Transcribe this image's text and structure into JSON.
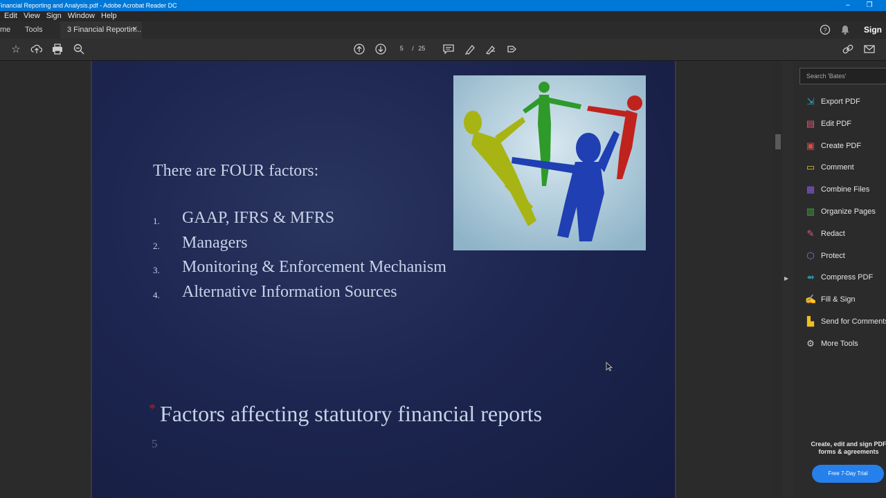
{
  "window": {
    "title": "Financial Reporting and Analysis.pdf - Adobe Acrobat Reader DC"
  },
  "menu": [
    "Edit",
    "View",
    "Sign",
    "Window",
    "Help"
  ],
  "tabs": {
    "home": "me",
    "tools": "Tools",
    "document": "3 Financial Reportin...",
    "sign_in": "Sign I"
  },
  "toolbar": {
    "current_page": "5",
    "page_separator": "/",
    "total_pages": "25"
  },
  "slide": {
    "heading": "There are FOUR factors:",
    "items": [
      {
        "num": "1.",
        "text": "GAAP, IFRS & MFRS"
      },
      {
        "num": "2.",
        "text": "Managers"
      },
      {
        "num": "3.",
        "text": "Monitoring & Enforcement Mechanism"
      },
      {
        "num": "4.",
        "text": "Alternative Information Sources"
      }
    ],
    "title_marker": "*",
    "title": "Factors affecting statutory financial reports",
    "page_number": "5"
  },
  "right_panel": {
    "search_placeholder": "Search 'Bates'",
    "tools": [
      {
        "label": "Export PDF",
        "icon": "export-pdf-icon",
        "color": "#2ab0c8"
      },
      {
        "label": "Edit PDF",
        "icon": "edit-pdf-icon",
        "color": "#e0587a"
      },
      {
        "label": "Create PDF",
        "icon": "create-pdf-icon",
        "color": "#e04848"
      },
      {
        "label": "Comment",
        "icon": "comment-icon",
        "color": "#f0c020"
      },
      {
        "label": "Combine Files",
        "icon": "combine-files-icon",
        "color": "#8a5ae0"
      },
      {
        "label": "Organize Pages",
        "icon": "organize-pages-icon",
        "color": "#40b040"
      },
      {
        "label": "Redact",
        "icon": "redact-icon",
        "color": "#e0587a"
      },
      {
        "label": "Protect",
        "icon": "protect-icon",
        "color": "#8a70e0"
      },
      {
        "label": "Compress PDF",
        "icon": "compress-pdf-icon",
        "color": "#2ab0c8"
      },
      {
        "label": "Fill & Sign",
        "icon": "fill-sign-icon",
        "color": "#a070e0"
      },
      {
        "label": "Send for Comments",
        "icon": "send-for-comments-icon",
        "color": "#f0c020"
      },
      {
        "label": "More Tools",
        "icon": "more-tools-icon",
        "color": "#cccccc"
      }
    ],
    "promo": "Create, edit and sign PDF forms & agreements",
    "trial_button": "Free 7-Day Trial"
  }
}
